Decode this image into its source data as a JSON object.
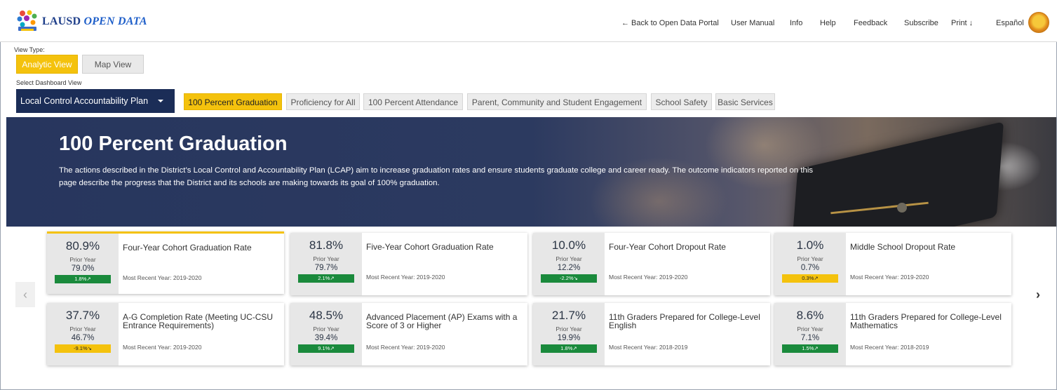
{
  "app": {
    "brand_main": "LAUSD",
    "brand_italic": "OPEN DATA"
  },
  "topnav": {
    "back": "← Back to Open Data Portal",
    "manual": "User Manual",
    "info": "Info",
    "help": "Help",
    "feedback": "Feedback",
    "subscribe": "Subscribe",
    "print": "Print ↓",
    "espanol": "Español"
  },
  "view_type": {
    "label": "View Type:",
    "analytic": "Analytic View",
    "map": "Map View"
  },
  "dashboard": {
    "label": "Select Dashboard View",
    "selected": "Local Control Accountability Plan"
  },
  "tabs": [
    "100 Percent Graduation",
    "Proficiency for All",
    "100 Percent Attendance",
    "Parent, Community and Student Engagement",
    "School Safety",
    "Basic Services"
  ],
  "hero": {
    "title": "100 Percent Graduation",
    "description": "The actions described in the District’s Local Control and Accountability Plan (LCAP) aim to increase graduation rates and ensure students graduate college and career ready. The outcome indicators reported on this page describe the progress that the District and its schools are making towards its goal of 100% graduation."
  },
  "nav": {
    "prev": "‹",
    "next": "›"
  },
  "cards": [
    {
      "value": "80.9%",
      "prior_label": "Prior Year",
      "prior": "79.0%",
      "change": "1.8%↗",
      "status": "green",
      "title": "Four-Year Cohort Graduation Rate",
      "year": "Most Recent Year: 2019-2020"
    },
    {
      "value": "81.8%",
      "prior_label": "Prior Year",
      "prior": "79.7%",
      "change": "2.1%↗",
      "status": "green",
      "title": "Five-Year Cohort Graduation Rate",
      "year": "Most Recent Year: 2019-2020"
    },
    {
      "value": "10.0%",
      "prior_label": "Prior Year",
      "prior": "12.2%",
      "change": "-2.2%↘",
      "status": "green",
      "title": "Four-Year Cohort Dropout Rate",
      "year": "Most Recent Year: 2019-2020"
    },
    {
      "value": "1.0%",
      "prior_label": "Prior Year",
      "prior": "0.7%",
      "change": "0.3%↗",
      "status": "yellow",
      "title": "Middle School Dropout Rate",
      "year": "Most Recent Year: 2019-2020"
    },
    {
      "value": "37.7%",
      "prior_label": "Prior Year",
      "prior": "46.7%",
      "change": "-9.1%↘",
      "status": "yellow",
      "title": "A-G Completion Rate (Meeting UC-CSU Entrance Requirements)",
      "year": "Most Recent Year: 2019-2020"
    },
    {
      "value": "48.5%",
      "prior_label": "Prior Year",
      "prior": "39.4%",
      "change": "9.1%↗",
      "status": "green",
      "title": "Advanced Placement (AP) Exams with a Score of 3 or Higher",
      "year": "Most Recent Year: 2019-2020"
    },
    {
      "value": "21.7%",
      "prior_label": "Prior Year",
      "prior": "19.9%",
      "change": "1.8%↗",
      "status": "green",
      "title": "11th Graders Prepared for College-Level English",
      "year": "Most Recent Year: 2018-2019"
    },
    {
      "value": "8.6%",
      "prior_label": "Prior Year",
      "prior": "7.1%",
      "change": "1.5%↗",
      "status": "green",
      "title": "11th Graders Prepared for College-Level Mathematics",
      "year": "Most Recent Year: 2018-2019"
    }
  ]
}
